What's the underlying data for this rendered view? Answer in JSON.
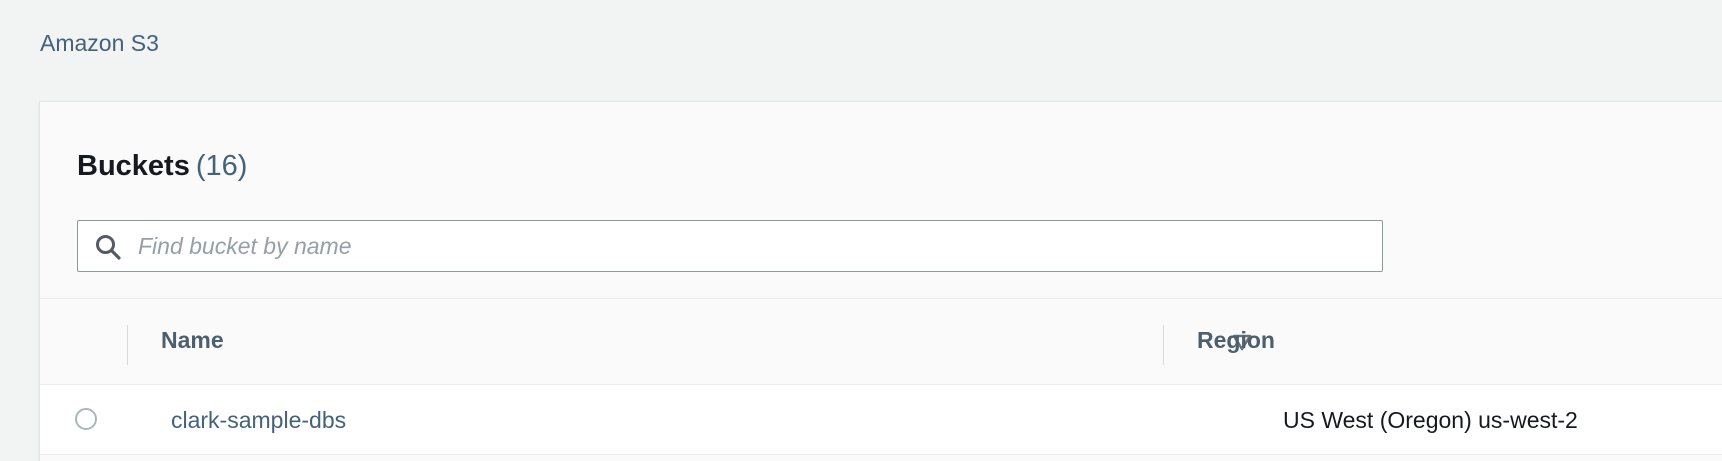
{
  "breadcrumb": {
    "root_label": "Amazon S3"
  },
  "buckets_panel": {
    "title": "Buckets",
    "count": "(16)",
    "search": {
      "placeholder": "Find bucket by name",
      "value": "",
      "icon": "search-icon"
    },
    "table": {
      "columns": [
        {
          "label": "Name",
          "sortable": true,
          "sort_icon": "sort-down-triangle-icon"
        },
        {
          "label": "Region"
        }
      ],
      "rows": [
        {
          "name": "clark-sample-dbs",
          "region": "US West (Oregon) us-west-2",
          "selected": false
        }
      ]
    }
  },
  "colors": {
    "page_background": "#f2f3f3",
    "link": "#44627a",
    "header_text": "#4b5f6e",
    "primary_text": "#16191f"
  }
}
